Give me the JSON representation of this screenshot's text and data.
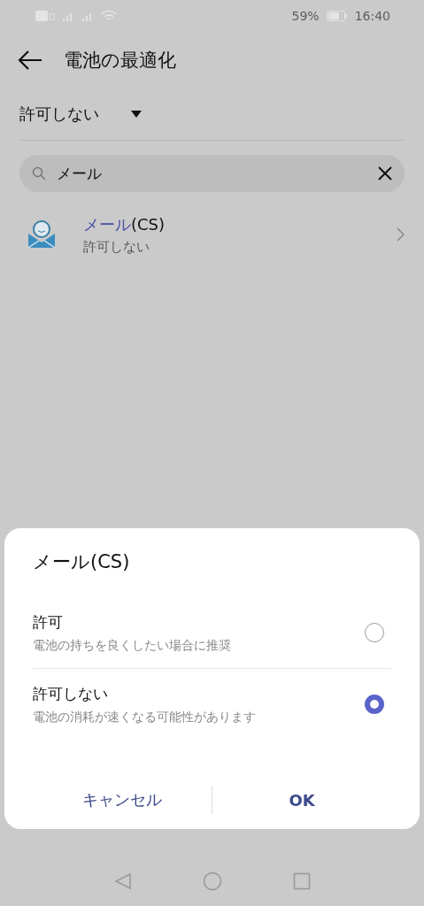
{
  "status_bar": {
    "battery_percent": "59%",
    "time": "16:40"
  },
  "header": {
    "title": "電池の最適化"
  },
  "filter": {
    "label": "許可しない"
  },
  "search": {
    "value": "メール"
  },
  "apps": [
    {
      "name_match": "メール",
      "name_rest": "(CS)",
      "status": "許可しない"
    }
  ],
  "dialog": {
    "title": "メール(CS)",
    "options": [
      {
        "label": "許可",
        "description": "電池の持ちを良くしたい場合に推奨",
        "selected": false
      },
      {
        "label": "許可しない",
        "description": "電池の消耗が速くなる可能性があります",
        "selected": true
      }
    ],
    "buttons": [
      {
        "label": "キャンセル",
        "kind": "cancel"
      },
      {
        "label": "OK",
        "kind": "ok"
      }
    ]
  }
}
